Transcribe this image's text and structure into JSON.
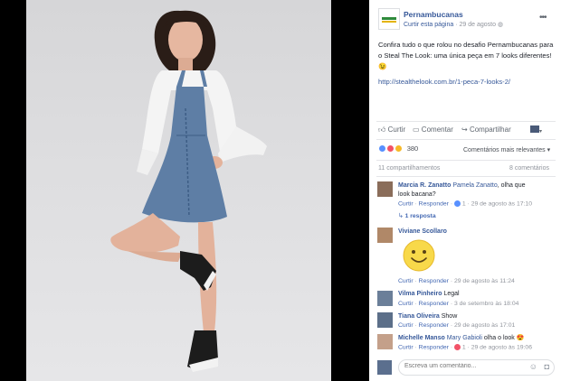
{
  "post": {
    "page_name": "Pernambucanas",
    "like_page": "Curtir esta página",
    "meta_sep": "·",
    "date": "29 de agosto",
    "text": "Confira tudo o que rolou no desafio Pernambucanas para o Steal The Look: uma única peça em 7 looks diferentes! 😉",
    "link": "http://stealthelook.com.br/1-peca-7-looks-2/"
  },
  "actions": {
    "like": "Curtir",
    "comment": "Comentar",
    "share": "Compartilhar"
  },
  "stats": {
    "reaction_count": "380",
    "sort_label": "Comentários mais relevantes",
    "shares": "11 compartilhamentos",
    "comments": "8 comentários"
  },
  "comments": [
    {
      "author": "Marcia R. Zanatto",
      "mention": "Pamela Zanatto",
      "text": ", olha que look bacana?",
      "like": "Curtir",
      "reply": "Responder",
      "likes": "1",
      "time": "29 de agosto às 17:10",
      "replies": "1 resposta"
    },
    {
      "author": "Viviane Scollaro",
      "like": "Curtir",
      "reply": "Responder",
      "time": "29 de agosto às 11:24"
    },
    {
      "author": "Vilma Pinheiro",
      "text": "Legal",
      "like": "Curtir",
      "reply": "Responder",
      "time": "3 de setembro às 18:04"
    },
    {
      "author": "Tiana Oliveira",
      "text": "Show",
      "like": "Curtir",
      "reply": "Responder",
      "time": "29 de agosto às 17:01"
    },
    {
      "author": "Michelle Manso",
      "mention": "Mary Gabioli",
      "text": " olha o look 😍",
      "like": "Curtir",
      "reply": "Responder",
      "likes": "1",
      "time": "29 de agosto às 19:06"
    }
  ],
  "composer": {
    "placeholder": "Escreva um comentário..."
  },
  "colors": {
    "facebook_blue": "#365899",
    "link_blue": "#4267b2",
    "meta_grey": "#90949c",
    "reaction_like": "#5890ff",
    "reaction_love": "#f25268",
    "reaction_haha": "#f7b928"
  },
  "icons": [
    "thumbs-up-icon",
    "comment-icon",
    "share-icon",
    "avatar-dropdown-icon",
    "options-icon",
    "camera-icon",
    "emoji-icon"
  ]
}
